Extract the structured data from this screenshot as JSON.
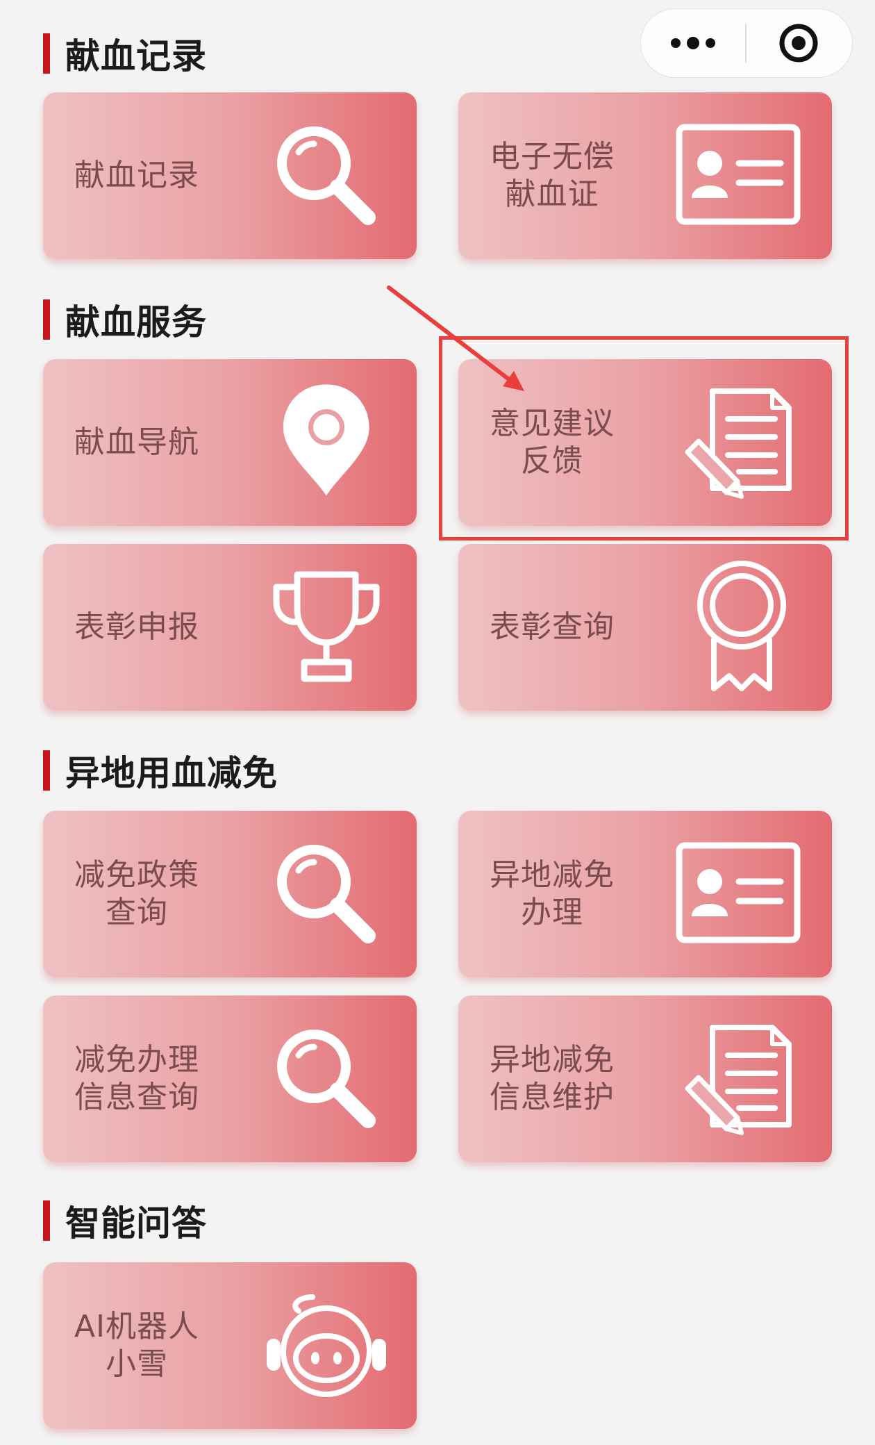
{
  "capsule": {
    "more_icon": "more-dots-icon",
    "close_icon": "target-close-icon"
  },
  "sections": {
    "record": {
      "title": "献血记录"
    },
    "service": {
      "title": "献血服务"
    },
    "offsite": {
      "title": "异地用血减免"
    },
    "qa": {
      "title": "智能问答"
    }
  },
  "cards": {
    "record_query": {
      "label": "献血记录",
      "icon": "magnifier-icon"
    },
    "e_certificate": {
      "label": "电子无偿\n献血证",
      "icon": "id-card-icon"
    },
    "navigation": {
      "label": "献血导航",
      "icon": "map-pin-icon"
    },
    "feedback": {
      "label": "意见建议\n反馈",
      "icon": "document-edit-icon"
    },
    "commend_apply": {
      "label": "表彰申报",
      "icon": "trophy-icon"
    },
    "commend_query": {
      "label": "表彰查询",
      "icon": "medal-icon"
    },
    "policy_query": {
      "label": "减免政策\n查询",
      "icon": "magnifier-icon"
    },
    "offsite_handle": {
      "label": "异地减免\n办理",
      "icon": "id-card-icon"
    },
    "handle_info_query": {
      "label": "减免办理\n信息查询",
      "icon": "magnifier-icon"
    },
    "offsite_info_maint": {
      "label": "异地减免\n信息维护",
      "icon": "document-edit-icon"
    },
    "ai_robot": {
      "label": "AI机器人\n小雪",
      "icon": "robot-icon"
    }
  },
  "colors": {
    "accent": "#c8161d",
    "card_start": "#efc1c3",
    "card_end": "#e36b71",
    "card_text": "#7a4c4e",
    "annotation": "#ec3d3d"
  }
}
